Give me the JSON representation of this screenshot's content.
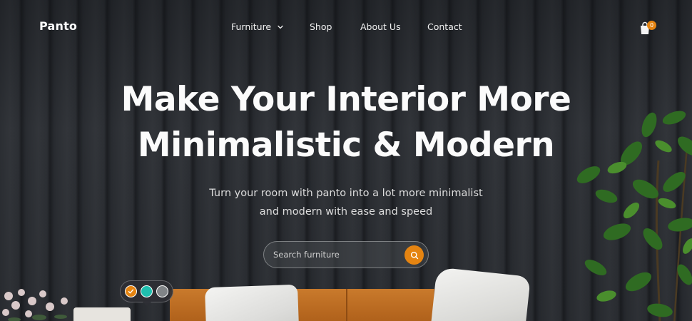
{
  "brand": {
    "name": "Panto"
  },
  "nav": {
    "items": [
      {
        "label": "Furniture",
        "has_dropdown": true
      },
      {
        "label": "Shop"
      },
      {
        "label": "About Us"
      },
      {
        "label": "Contact"
      }
    ]
  },
  "cart": {
    "count": "0",
    "icon": "shopping-bag-icon"
  },
  "hero": {
    "title_line1": "Make Your Interior More",
    "title_line2": "Minimalistic & Modern",
    "subtitle_line1": "Turn your room with panto into a lot more minimalist",
    "subtitle_line2": "and modern with ease and speed"
  },
  "search": {
    "placeholder": "Search furniture",
    "icon": "search-icon"
  },
  "color_options": {
    "swatches": [
      {
        "color": "#e58411",
        "selected": true
      },
      {
        "color": "#1fbfae",
        "selected": false
      },
      {
        "color": "#808487",
        "selected": false
      }
    ]
  },
  "colors": {
    "accent": "#e58411",
    "background": "#2b2e33",
    "text": "#ffffff"
  }
}
